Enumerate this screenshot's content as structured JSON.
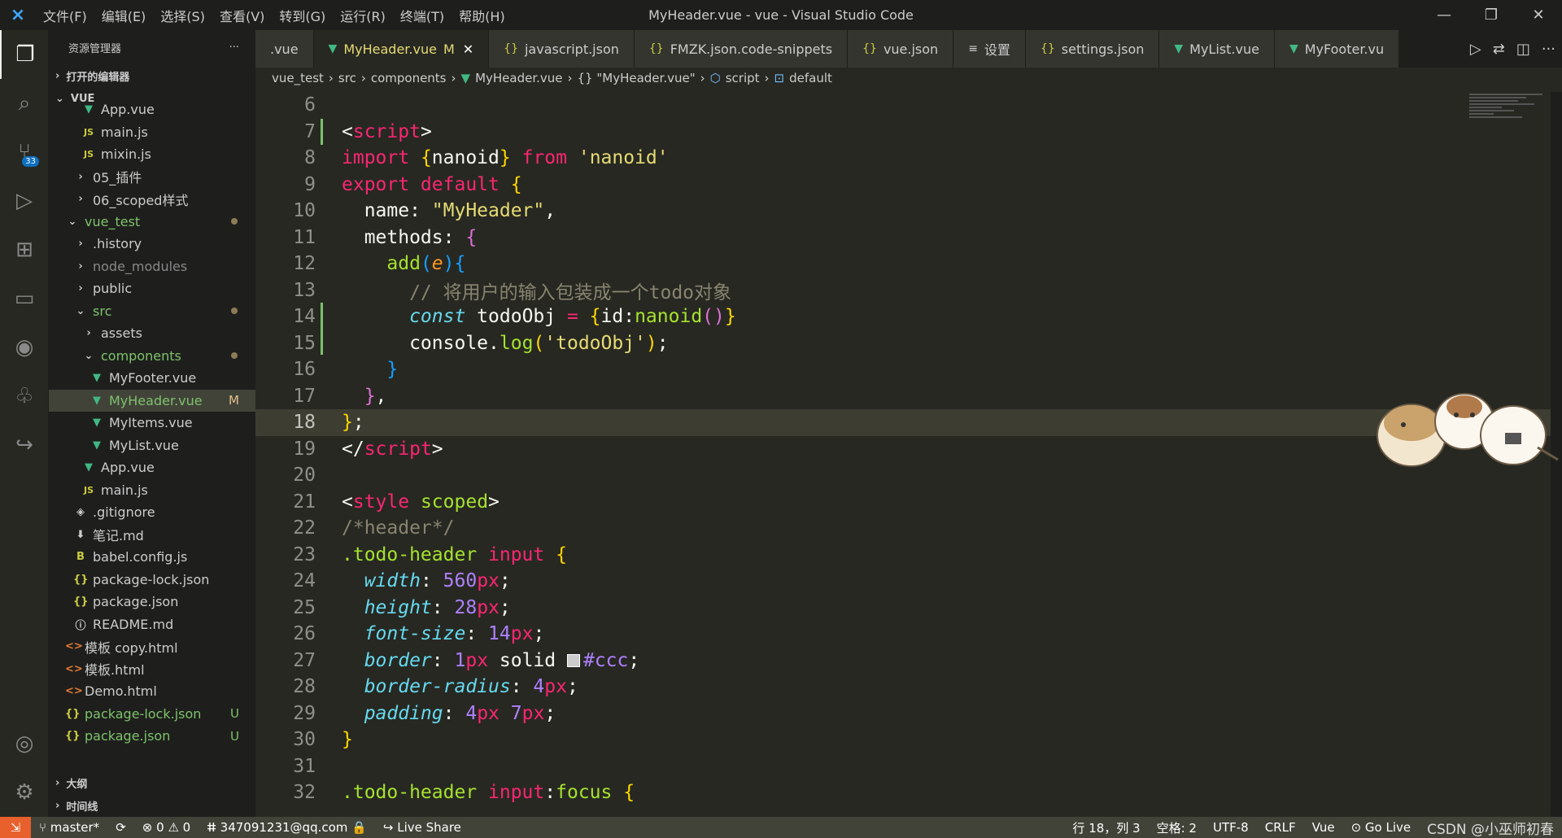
{
  "titlebar": {
    "menu": [
      "文件(F)",
      "编辑(E)",
      "选择(S)",
      "查看(V)",
      "转到(G)",
      "运行(R)",
      "终端(T)",
      "帮助(H)"
    ],
    "title": "MyHeader.vue - vue - Visual Studio Code"
  },
  "activity": {
    "scm_badge": "33"
  },
  "sidebar": {
    "title": "资源管理器",
    "more": "···",
    "open_editors": "打开的编辑器",
    "root": "VUE",
    "items": [
      {
        "label": "App.vue",
        "icon": "vue",
        "depth": 2
      },
      {
        "label": "main.js",
        "icon": "js",
        "depth": 2
      },
      {
        "label": "mixin.js",
        "icon": "js",
        "depth": 2
      },
      {
        "label": "05_插件",
        "icon": "folder",
        "depth": 1
      },
      {
        "label": "06_scoped样式",
        "icon": "folder",
        "depth": 1
      },
      {
        "label": "vue_test",
        "icon": "folder-open",
        "depth": 0,
        "dot": true,
        "green": true
      },
      {
        "label": ".history",
        "icon": "folder",
        "depth": 1
      },
      {
        "label": "node_modules",
        "icon": "folder",
        "depth": 1,
        "dim": true
      },
      {
        "label": "public",
        "icon": "folder",
        "depth": 1
      },
      {
        "label": "src",
        "icon": "folder-open",
        "depth": 1,
        "dot": true,
        "green": true
      },
      {
        "label": "assets",
        "icon": "folder",
        "depth": 2
      },
      {
        "label": "components",
        "icon": "folder-open",
        "depth": 2,
        "dot": true,
        "green": true
      },
      {
        "label": "MyFooter.vue",
        "icon": "vue",
        "depth": 3
      },
      {
        "label": "MyHeader.vue",
        "icon": "vue",
        "depth": 3,
        "status": "M",
        "selected": true,
        "green": true
      },
      {
        "label": "MyItems.vue",
        "icon": "vue",
        "depth": 3
      },
      {
        "label": "MyList.vue",
        "icon": "vue",
        "depth": 3
      },
      {
        "label": "App.vue",
        "icon": "vue",
        "depth": 2
      },
      {
        "label": "main.js",
        "icon": "js",
        "depth": 2
      },
      {
        "label": ".gitignore",
        "icon": "git",
        "depth": 1
      },
      {
        "label": "笔记.md",
        "icon": "md",
        "depth": 1
      },
      {
        "label": "babel.config.js",
        "icon": "babel",
        "depth": 1
      },
      {
        "label": "package-lock.json",
        "icon": "json",
        "depth": 1
      },
      {
        "label": "package.json",
        "icon": "json",
        "depth": 1
      },
      {
        "label": "README.md",
        "icon": "info",
        "depth": 1
      },
      {
        "label": "模板 copy.html",
        "icon": "html",
        "depth": 0
      },
      {
        "label": "模板.html",
        "icon": "html",
        "depth": 0
      },
      {
        "label": "Demo.html",
        "icon": "html",
        "depth": 0
      },
      {
        "label": "package-lock.json",
        "icon": "json",
        "depth": 0,
        "status": "U",
        "green": true
      },
      {
        "label": "package.json",
        "icon": "json",
        "depth": 0,
        "status": "U",
        "green": true
      }
    ],
    "outline": "大纲",
    "timeline": "时间线"
  },
  "tabs": [
    {
      "label": ".vue",
      "icon": "",
      "active": false
    },
    {
      "label": "MyHeader.vue",
      "icon": "vue",
      "active": true,
      "modified": "M",
      "close": "✕"
    },
    {
      "label": "javascript.json",
      "icon": "json",
      "active": false
    },
    {
      "label": "FMZK.json.code-snippets",
      "icon": "json",
      "active": false
    },
    {
      "label": "vue.json",
      "icon": "json",
      "active": false
    },
    {
      "label": "设置",
      "icon": "settings",
      "active": false
    },
    {
      "label": "settings.json",
      "icon": "json",
      "active": false
    },
    {
      "label": "MyList.vue",
      "icon": "vue",
      "active": false
    },
    {
      "label": "MyFooter.vu",
      "icon": "vue",
      "active": false
    }
  ],
  "breadcrumb": [
    "vue_test",
    "src",
    "components",
    "MyHeader.vue",
    "{} \"MyHeader.vue\"",
    "script",
    "default"
  ],
  "editor": {
    "current_line": 18,
    "lines": [
      {
        "n": "6",
        "tokens": []
      },
      {
        "n": "7",
        "tokens": [
          [
            "w",
            "<"
          ],
          [
            "k",
            "script"
          ],
          [
            "w",
            ">"
          ]
        ]
      },
      {
        "n": "8",
        "tokens": [
          [
            "k",
            "import "
          ],
          [
            "br1",
            "{"
          ],
          [
            "w",
            "nanoid"
          ],
          [
            "br1",
            "}"
          ],
          [
            "k",
            " from "
          ],
          [
            "s",
            "'nanoid'"
          ]
        ]
      },
      {
        "n": "9",
        "tokens": [
          [
            "k",
            "export default "
          ],
          [
            "br1",
            "{"
          ]
        ]
      },
      {
        "n": "10",
        "tokens": [
          [
            "w",
            "  name: "
          ],
          [
            "s",
            "\"MyHeader\""
          ],
          [
            "w",
            ","
          ]
        ]
      },
      {
        "n": "11",
        "tokens": [
          [
            "w",
            "  methods: "
          ],
          [
            "br2",
            "{"
          ]
        ]
      },
      {
        "n": "12",
        "tokens": [
          [
            "f",
            "    add"
          ],
          [
            "br3",
            "("
          ],
          [
            "p",
            "e"
          ],
          [
            "br3",
            ")"
          ],
          [
            "br3",
            "{"
          ]
        ]
      },
      {
        "n": "13",
        "tokens": [
          [
            "c",
            "      // 将用户的输入包装成一个todo对象"
          ]
        ]
      },
      {
        "n": "14",
        "tokens": [
          [
            "it",
            "      const"
          ],
          [
            "w",
            " todoObj "
          ],
          [
            "k",
            "="
          ],
          [
            "w",
            " "
          ],
          [
            "br1",
            "{"
          ],
          [
            "w",
            "id:"
          ],
          [
            "f",
            "nanoid"
          ],
          [
            "br2",
            "()"
          ],
          [
            "br1",
            "}"
          ]
        ]
      },
      {
        "n": "15",
        "tokens": [
          [
            "w",
            "      console."
          ],
          [
            "f",
            "log"
          ],
          [
            "br1",
            "("
          ],
          [
            "s",
            "'todoObj'"
          ],
          [
            "br1",
            ")"
          ],
          [
            "w",
            ";"
          ]
        ]
      },
      {
        "n": "16",
        "tokens": [
          [
            "br3",
            "    }"
          ]
        ]
      },
      {
        "n": "17",
        "tokens": [
          [
            "br2",
            "  }"
          ],
          [
            "w",
            ","
          ]
        ]
      },
      {
        "n": "18",
        "tokens": [
          [
            "br1",
            "}"
          ],
          [
            "w",
            ";"
          ]
        ]
      },
      {
        "n": "19",
        "tokens": [
          [
            "w",
            "</"
          ],
          [
            "k",
            "script"
          ],
          [
            "w",
            ">"
          ]
        ]
      },
      {
        "n": "20",
        "tokens": []
      },
      {
        "n": "21",
        "tokens": [
          [
            "w",
            "<"
          ],
          [
            "k",
            "style"
          ],
          [
            "f",
            " scoped"
          ],
          [
            "w",
            ">"
          ]
        ]
      },
      {
        "n": "22",
        "tokens": [
          [
            "c",
            "/*header*/"
          ]
        ]
      },
      {
        "n": "23",
        "tokens": [
          [
            "f",
            ".todo-header "
          ],
          [
            "k",
            "input "
          ],
          [
            "br1",
            "{"
          ]
        ]
      },
      {
        "n": "24",
        "tokens": [
          [
            "it",
            "  width"
          ],
          [
            "w",
            ": "
          ],
          [
            "n",
            "560"
          ],
          [
            "k",
            "px"
          ],
          [
            "w",
            ";"
          ]
        ]
      },
      {
        "n": "25",
        "tokens": [
          [
            "it",
            "  height"
          ],
          [
            "w",
            ": "
          ],
          [
            "n",
            "28"
          ],
          [
            "k",
            "px"
          ],
          [
            "w",
            ";"
          ]
        ]
      },
      {
        "n": "26",
        "tokens": [
          [
            "it",
            "  font-size"
          ],
          [
            "w",
            ": "
          ],
          [
            "n",
            "14"
          ],
          [
            "k",
            "px"
          ],
          [
            "w",
            ";"
          ]
        ]
      },
      {
        "n": "27",
        "tokens": [
          [
            "it",
            "  border"
          ],
          [
            "w",
            ": "
          ],
          [
            "n",
            "1"
          ],
          [
            "k",
            "px"
          ],
          [
            "w",
            " solid "
          ],
          [
            "sw",
            "#ccc"
          ],
          [
            "n",
            "#ccc"
          ],
          [
            "w",
            ";"
          ]
        ]
      },
      {
        "n": "28",
        "tokens": [
          [
            "it",
            "  border-radius"
          ],
          [
            "w",
            ": "
          ],
          [
            "n",
            "4"
          ],
          [
            "k",
            "px"
          ],
          [
            "w",
            ";"
          ]
        ]
      },
      {
        "n": "29",
        "tokens": [
          [
            "it",
            "  padding"
          ],
          [
            "w",
            ": "
          ],
          [
            "n",
            "4"
          ],
          [
            "k",
            "px"
          ],
          [
            "w",
            " "
          ],
          [
            "n",
            "7"
          ],
          [
            "k",
            "px"
          ],
          [
            "w",
            ";"
          ]
        ]
      },
      {
        "n": "30",
        "tokens": [
          [
            "br1",
            "}"
          ]
        ]
      },
      {
        "n": "31",
        "tokens": []
      },
      {
        "n": "32",
        "tokens": [
          [
            "f",
            ".todo-header "
          ],
          [
            "k",
            "input"
          ],
          [
            "w",
            ":"
          ],
          [
            "f",
            "focus "
          ],
          [
            "br1",
            "{"
          ]
        ]
      }
    ]
  },
  "statusbar": {
    "branch": "master*",
    "errors": "⊗ 0",
    "warnings": "⚠ 0",
    "account": "347091231@qq.com",
    "liveshare": "Live Share",
    "position": "行 18，列 3",
    "spaces": "空格: 2",
    "encoding": "UTF-8",
    "eol": "CRLF",
    "language": "Vue",
    "golive": "Go Live",
    "watermark": "CSDN @小巫师初春"
  },
  "colors": {
    "accent": "#f92672",
    "string": "#e6db74",
    "function": "#a6e22e",
    "status_remote": "#e8602c"
  }
}
